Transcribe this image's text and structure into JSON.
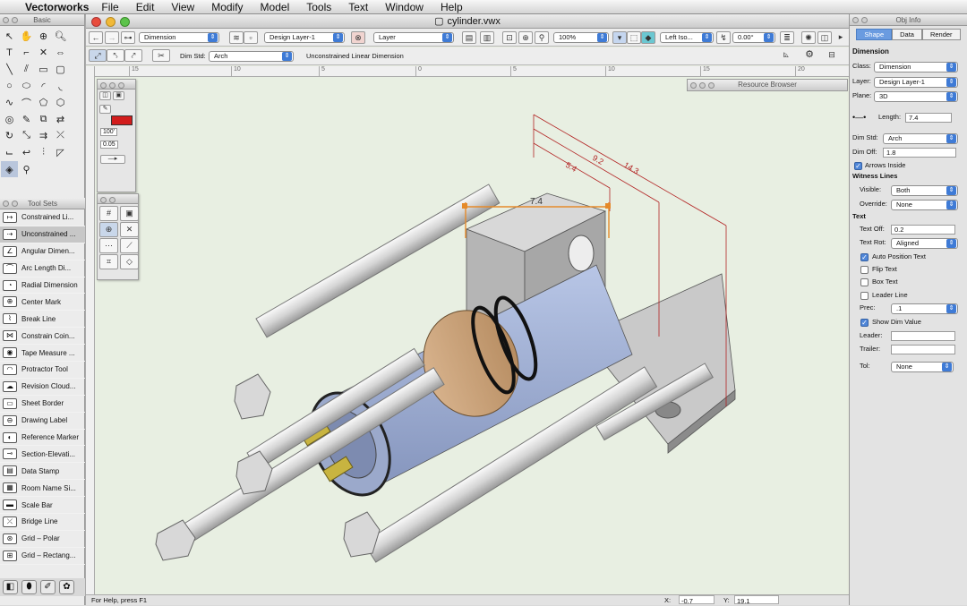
{
  "menubar": {
    "app": "Vectorworks",
    "items": [
      "File",
      "Edit",
      "View",
      "Modify",
      "Model",
      "Tools",
      "Text",
      "Window",
      "Help"
    ]
  },
  "palettes": {
    "basic_title": "Basic",
    "toolsets_title": "Tool Sets",
    "resource_title": "Resource Browser",
    "objinfo_title": "Obj Info"
  },
  "toolsets": [
    {
      "label": "Constrained Li...",
      "icon": "constrained-linear-icon"
    },
    {
      "label": "Unconstrained ...",
      "icon": "unconstrained-linear-icon",
      "selected": true
    },
    {
      "label": "Angular Dimen...",
      "icon": "angular-dimension-icon"
    },
    {
      "label": "Arc Length Di...",
      "icon": "arc-length-icon"
    },
    {
      "label": "Radial Dimension",
      "icon": "radial-dimension-icon"
    },
    {
      "label": "Center Mark",
      "icon": "center-mark-icon"
    },
    {
      "label": "Break Line",
      "icon": "break-line-icon"
    },
    {
      "label": "Constrain Coin...",
      "icon": "constrain-coincident-icon"
    },
    {
      "label": "Tape Measure ...",
      "icon": "tape-measure-icon"
    },
    {
      "label": "Protractor Tool",
      "icon": "protractor-icon"
    },
    {
      "label": "Revision Cloud...",
      "icon": "revision-cloud-icon"
    },
    {
      "label": "Sheet Border",
      "icon": "sheet-border-icon"
    },
    {
      "label": "Drawing Label",
      "icon": "drawing-label-icon"
    },
    {
      "label": "Reference Marker",
      "icon": "reference-marker-icon"
    },
    {
      "label": "Section-Elevati...",
      "icon": "section-elevation-icon"
    },
    {
      "label": "Data Stamp",
      "icon": "data-stamp-icon"
    },
    {
      "label": "Room Name Si...",
      "icon": "room-name-icon"
    },
    {
      "label": "Scale Bar",
      "icon": "scale-bar-icon"
    },
    {
      "label": "Bridge Line",
      "icon": "bridge-line-icon"
    },
    {
      "label": "Grid – Polar",
      "icon": "grid-polar-icon"
    },
    {
      "label": "Grid – Rectang...",
      "icon": "grid-rectangular-icon"
    }
  ],
  "document": {
    "title": "cylinder.vwx",
    "class_popup": "Dimension",
    "layer_popup": "Design Layer-1",
    "layer_label": "Layer",
    "zoom": "100%",
    "view_popup": "Left Iso...",
    "rotation": "0.00°",
    "dim_std_label": "Dim Std:",
    "dim_std_value": "Arch",
    "mode_text": "Unconstrained Linear Dimension",
    "status_help": "For Help, press F1",
    "coord_x_label": "X:",
    "coord_x": "-0.7",
    "coord_y_label": "Y:",
    "coord_y": "19.1",
    "ruler_ticks": [
      "15",
      "10",
      "5",
      "0",
      "5",
      "10",
      "15",
      "20"
    ]
  },
  "attributes": {
    "line_weight": "100'",
    "thickness": "0.05"
  },
  "drawing": {
    "dimensions": [
      "7.4",
      "5.4",
      "9.2",
      "14.3"
    ]
  },
  "objinfo": {
    "tabs": [
      "Shape",
      "Data",
      "Render"
    ],
    "active_tab": "Shape",
    "header": "Dimension",
    "class": "Dimension",
    "layer": "Design Layer-1",
    "plane": "3D",
    "length_label": "Length:",
    "length": "7.4",
    "dim_std": "Arch",
    "dim_off": "1.8",
    "arrows_inside": "Arrows Inside",
    "witness_lines": "Witness Lines",
    "visible": "Both",
    "override": "None",
    "text_section": "Text",
    "text_off": "0.2",
    "text_rot": "Aligned",
    "auto_position": "Auto Position Text",
    "flip_text": "Flip Text",
    "box_text": "Box Text",
    "leader_line": "Leader Line",
    "prec": ".1",
    "show_dim_value": "Show Dim Value",
    "leader": "",
    "trailer": "",
    "tol": "None",
    "labels": {
      "class": "Class:",
      "layer": "Layer:",
      "plane": "Plane:",
      "dim_std": "Dim Std:",
      "dim_off": "Dim Off:",
      "visible": "Visible:",
      "override": "Override:",
      "text_off": "Text Off:",
      "text_rot": "Text Rot:",
      "prec": "Prec:",
      "leader": "Leader:",
      "trailer": "Trailer:",
      "tol": "Tol:"
    }
  },
  "colors": {
    "dimension_line": "#b22222",
    "selection": "#e58a2a",
    "canvas": "#e8efe2"
  }
}
